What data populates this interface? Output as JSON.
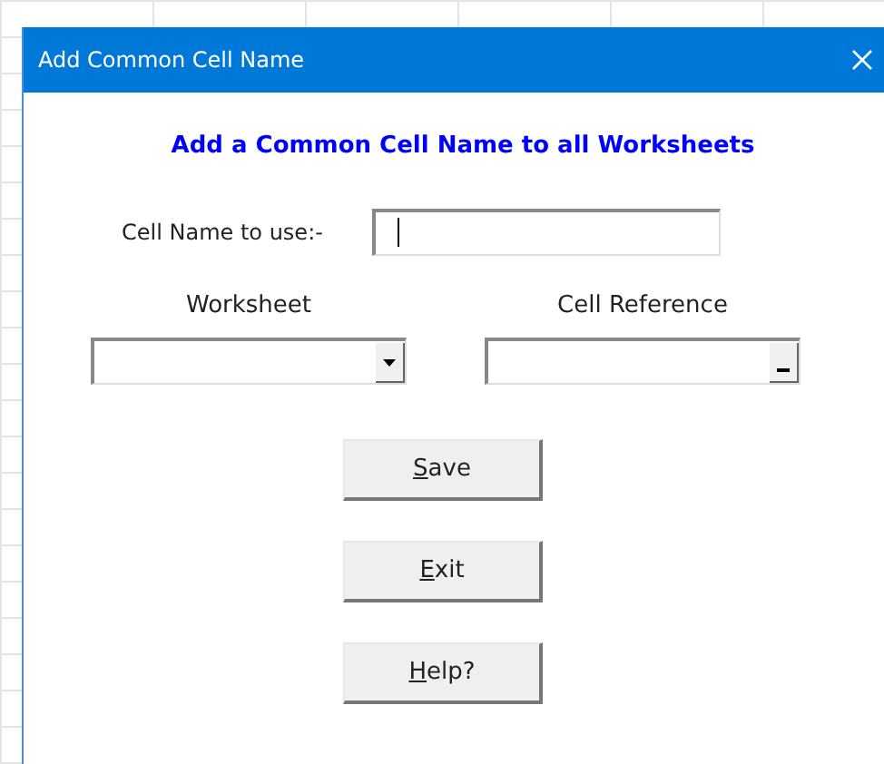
{
  "window": {
    "title": "Add Common Cell Name"
  },
  "heading": "Add a Common Cell Name to all Worksheets",
  "cell_name": {
    "label": "Cell Name to use:-",
    "focused": true
  },
  "worksheet": {
    "label": "Worksheet",
    "kind": "dropdown"
  },
  "cell_reference": {
    "label": "Cell Reference",
    "kind": "ref-picker"
  },
  "buttons": [
    {
      "label": "Save",
      "mnemonic_underlined": true
    },
    {
      "label": "Exit",
      "mnemonic_underlined": true
    },
    {
      "label": "Help?",
      "mnemonic_underlined": true
    }
  ]
}
